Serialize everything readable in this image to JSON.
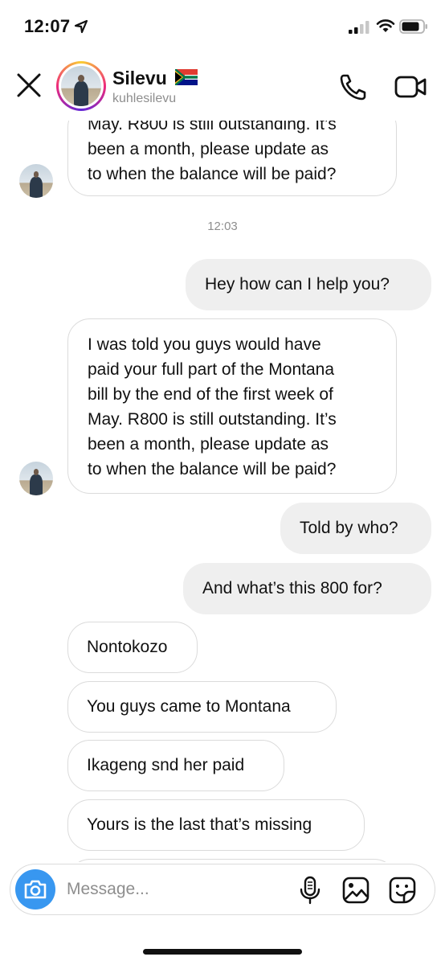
{
  "status_bar": {
    "time": "12:07"
  },
  "header": {
    "name": "Silevu",
    "username": "kuhlesilevu"
  },
  "messages": [
    {
      "id": "m1",
      "direction": "in",
      "lines": [
        "May. R800 is still outstanding. It’s",
        "been a month, please update as",
        "to when the balance will be paid?"
      ]
    },
    {
      "id": "ts",
      "type": "timestamp",
      "text": "12:03"
    },
    {
      "id": "m2",
      "direction": "out",
      "lines": [
        "Hey how can I help you?"
      ]
    },
    {
      "id": "m3",
      "direction": "in",
      "lines": [
        "I was told you guys would have",
        "paid your full part of the Montana",
        "bill by the end of the first week of",
        "May. R800 is still outstanding. It’s",
        "been a month, please update as",
        "to when the balance will be paid?"
      ]
    },
    {
      "id": "m4",
      "direction": "out",
      "lines": [
        "Told by who?"
      ]
    },
    {
      "id": "m5",
      "direction": "out",
      "lines": [
        "And what’s this 800 for?"
      ]
    },
    {
      "id": "m6",
      "direction": "in",
      "lines": [
        "Nontokozo"
      ]
    },
    {
      "id": "m7",
      "direction": "in",
      "lines": [
        "You guys came to Montana"
      ]
    },
    {
      "id": "m8",
      "direction": "in",
      "lines": [
        "Ikageng snd her paid"
      ]
    },
    {
      "id": "m9",
      "direction": "in",
      "lines": [
        "Yours is the last that’s missing"
      ]
    }
  ],
  "composer": {
    "placeholder": "Message..."
  },
  "icons": {
    "close": "close-icon",
    "call": "phone-icon",
    "video": "video-camera-icon",
    "camera": "camera-icon",
    "mic": "microphone-icon",
    "gallery": "gallery-icon",
    "sticker": "sticker-icon",
    "location": "location-arrow-icon",
    "signal": "cellular-signal-icon",
    "wifi": "wifi-icon",
    "battery": "battery-icon"
  },
  "colors": {
    "accent": "#3897f0",
    "outgoing_bubble": "#efefef",
    "incoming_border": "#dbdbdb",
    "muted_text": "#8e8e8e"
  }
}
